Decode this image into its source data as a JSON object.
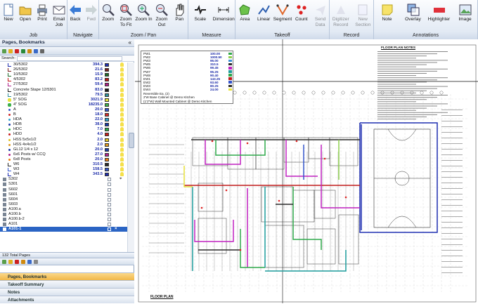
{
  "ribbon": {
    "groups": [
      {
        "label": "Job",
        "buttons": [
          {
            "label": "New",
            "icon": "new-document-icon"
          },
          {
            "label": "Open",
            "icon": "open-folder-icon"
          },
          {
            "label": "Print",
            "icon": "printer-icon"
          },
          {
            "label": "Email Job",
            "icon": "email-icon"
          }
        ]
      },
      {
        "label": "Navigate",
        "buttons": [
          {
            "label": "Back",
            "icon": "back-arrow-icon"
          },
          {
            "label": "Fwd",
            "icon": "forward-arrow-icon"
          }
        ]
      },
      {
        "label": "Zoom / Pan",
        "buttons": [
          {
            "label": "Zoom",
            "icon": "zoom-icon"
          },
          {
            "label": "Zoom To Fit",
            "icon": "zoom-to-fit-icon"
          },
          {
            "label": "Zoom In",
            "icon": "zoom-in-icon"
          },
          {
            "label": "Zoom Out",
            "icon": "zoom-out-icon"
          },
          {
            "label": "Pan",
            "icon": "hand-pan-icon"
          }
        ]
      },
      {
        "label": "Measure",
        "buttons": [
          {
            "label": "Scale",
            "icon": "scale-icon"
          },
          {
            "label": "Dimension",
            "icon": "dimension-icon"
          }
        ]
      },
      {
        "label": "Takeoff",
        "buttons": [
          {
            "label": "Area",
            "icon": "area-icon"
          },
          {
            "label": "Linear",
            "icon": "linear-icon"
          },
          {
            "label": "Segment",
            "icon": "segment-icon"
          },
          {
            "label": "Count",
            "icon": "count-icon"
          },
          {
            "label": "Send Data",
            "icon": "send-data-icon"
          }
        ]
      },
      {
        "label": "Record",
        "buttons": [
          {
            "label": "Digitizer Record",
            "icon": "digitizer-icon"
          },
          {
            "label": "New Section",
            "icon": "new-section-icon"
          }
        ]
      },
      {
        "label": "Annotations",
        "buttons": [
          {
            "label": "Note",
            "icon": "note-icon"
          },
          {
            "label": "Overlay",
            "icon": "overlay-icon"
          },
          {
            "label": "Highlighter",
            "icon": "highlighter-icon"
          },
          {
            "label": "Image",
            "icon": "image-icon"
          }
        ]
      }
    ]
  },
  "panel": {
    "title": "Pages, Bookmarks",
    "collapse_glyph": "«",
    "search_label": "Search:",
    "total_pages": "132 Total Pages",
    "close_glyph": "×",
    "pin_glyph": "⌖"
  },
  "tree": [
    {
      "name": "30/5302",
      "value": "394.3",
      "color": "#1f2fb0",
      "ind": 1,
      "icon": "linear"
    },
    {
      "name": "26/5302",
      "value": "21.6",
      "color": "#7a1f1f",
      "ind": 1,
      "icon": "linear"
    },
    {
      "name": "10/5302",
      "value": "15.9",
      "color": "#1f6b2a",
      "ind": 1,
      "icon": "linear"
    },
    {
      "name": "4/5302",
      "value": "83.2",
      "color": "#c01818",
      "ind": 1,
      "icon": "linear"
    },
    {
      "name": "27/5302",
      "value": "59.4",
      "color": "#b0228c",
      "ind": 1,
      "icon": "linear"
    },
    {
      "name": "Concrete Stape 12/5301",
      "value": "83.0",
      "color": "#1c1c1c",
      "ind": 1,
      "icon": "linear"
    },
    {
      "name": "19/5302",
      "value": "79.5",
      "color": "#2e8f9a",
      "ind": 1,
      "icon": "linear"
    },
    {
      "name": "5\" SOG",
      "value": "3021.9",
      "color": "#e8e23a",
      "ind": 1,
      "icon": "area"
    },
    {
      "name": "4\" SOG",
      "value": "18235.0",
      "color": "#3cb04a",
      "ind": 1,
      "icon": "area"
    },
    {
      "name": "A",
      "value": "20.0",
      "color": "#3355cc",
      "ind": 1,
      "icon": "count"
    },
    {
      "name": "B",
      "value": "18.0",
      "color": "#d12a2a",
      "ind": 1,
      "icon": "count"
    },
    {
      "name": "HDA",
      "value": "22.0",
      "color": "#2aa0d1",
      "ind": 1,
      "icon": "count"
    },
    {
      "name": "HDB",
      "value": "38.0",
      "color": "#1a3aa8",
      "ind": 1,
      "icon": "count"
    },
    {
      "name": "HDC",
      "value": "7.0",
      "color": "#2ab04a",
      "ind": 1,
      "icon": "count"
    },
    {
      "name": "HDD",
      "value": "4.0",
      "color": "#c81e1e",
      "ind": 1,
      "icon": "count"
    },
    {
      "name": "HSS 5x5x1/2",
      "value": "2.0",
      "color": "#e0c020",
      "ind": 1,
      "icon": "count"
    },
    {
      "name": "HSS 4x4x1/2",
      "value": "2.0",
      "color": "#e09a20",
      "ind": 1,
      "icon": "count"
    },
    {
      "name": "GL12 1/4 x 12",
      "value": "20.0",
      "color": "#1a3aa8",
      "ind": 1,
      "icon": "count"
    },
    {
      "name": "6x6 Posts w/ CCQ",
      "value": "27.0",
      "color": "#b0228c",
      "ind": 1,
      "icon": "count"
    },
    {
      "name": "6x8 Posts",
      "value": "20.0",
      "color": "#ec7a10",
      "ind": 1,
      "icon": "count"
    },
    {
      "name": "W6",
      "value": "310.5",
      "color": "#2a2a2a",
      "ind": 1,
      "icon": "linear"
    },
    {
      "name": "W3",
      "value": "158.5",
      "color": "#3355cc",
      "ind": 1,
      "icon": "linear"
    },
    {
      "name": "W4",
      "value": "343.5",
      "color": "#1f2fb0",
      "ind": 1,
      "icon": "linear"
    },
    {
      "name": "S302",
      "value": "",
      "color": "",
      "ind": 0,
      "icon": "page"
    },
    {
      "name": "S301",
      "value": "",
      "color": "",
      "ind": 0,
      "icon": "page"
    },
    {
      "name": "S602",
      "value": "",
      "color": "",
      "ind": 0,
      "icon": "page"
    },
    {
      "name": "S601",
      "value": "",
      "color": "",
      "ind": 0,
      "icon": "page"
    },
    {
      "name": "S604",
      "value": "",
      "color": "",
      "ind": 0,
      "icon": "page"
    },
    {
      "name": "S603",
      "value": "",
      "color": "",
      "ind": 0,
      "icon": "page"
    },
    {
      "name": "A100.a",
      "value": "",
      "color": "",
      "ind": 0,
      "icon": "page"
    },
    {
      "name": "A100.b",
      "value": "",
      "color": "",
      "ind": 0,
      "icon": "page"
    },
    {
      "name": "A100.b-2",
      "value": "",
      "color": "",
      "ind": 0,
      "icon": "page"
    },
    {
      "name": "A101",
      "value": "",
      "color": "",
      "ind": 0,
      "icon": "page"
    },
    {
      "name": "A101-1",
      "value": "",
      "color": "",
      "ind": 0,
      "icon": "page",
      "selected": true
    }
  ],
  "accordion": [
    "Pages, Bookmarks",
    "Takeoff Summary",
    "Notes",
    "Attachments"
  ],
  "plan": {
    "legend": [
      {
        "name": "PW1",
        "value": "100.00",
        "color": "#2ea84a"
      },
      {
        "name": "PW2",
        "value": "1000.50",
        "color": "#8fd04f"
      },
      {
        "name": "PW3",
        "value": "95.00",
        "color": "#3a8fd8"
      },
      {
        "name": "PW5",
        "value": "310.5",
        "color": "#2a2a2a"
      },
      {
        "name": "PW6",
        "value": "99.45",
        "color": "#c020c0"
      },
      {
        "name": "PW7",
        "value": "95.25",
        "color": "#1c9c9c"
      },
      {
        "name": "PW8",
        "value": "90.40",
        "color": "#2ea84a"
      },
      {
        "name": "EW1",
        "value": "143.25",
        "color": "#c01818"
      },
      {
        "name": "EW2",
        "value": "93.60",
        "color": "#3355cc"
      },
      {
        "name": "EW3",
        "value": "80.25",
        "color": "#2a2a2a"
      },
      {
        "name": "EW4",
        "value": "24.00",
        "color": "#e8e23a"
      }
    ],
    "notes": [
      "Reversible Ea. (2)",
      "2'W Base Cabinet @ Demo Kitchen",
      "(1'2\"W) Wall Mounted Cabinet @ Demo Kitchen"
    ],
    "sheet_title": "FLOOR PLAN NOTES",
    "plan_label": "FLOOR PLAN"
  }
}
